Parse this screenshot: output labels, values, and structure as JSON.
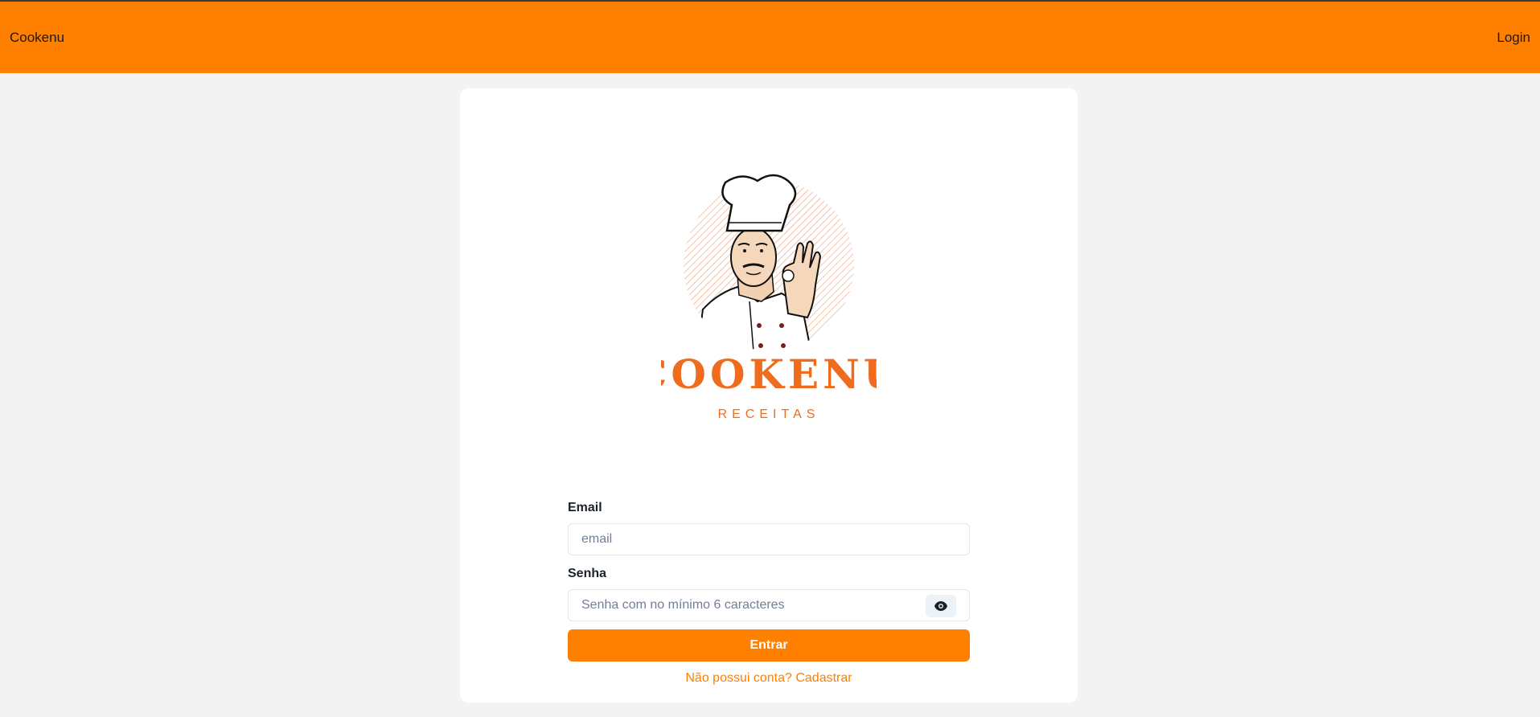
{
  "header": {
    "brand": "Cookenu",
    "login_label": "Login",
    "background": "#ff7f00"
  },
  "logo": {
    "title": "COOKENU",
    "subtitle": "RECEITAS",
    "color": "#ef6c1e"
  },
  "form": {
    "email_label": "Email",
    "email_placeholder": "email",
    "email_value": "",
    "password_label": "Senha",
    "password_placeholder": "Senha com no mínimo 6 caracteres",
    "password_value": "",
    "show_password_icon": "eye-icon",
    "submit_label": "Entrar",
    "signup_text": "Não possui conta? Cadastrar"
  },
  "colors": {
    "accent": "#ff7f00",
    "page_background": "#f3f3f3",
    "card_background": "#ffffff"
  }
}
